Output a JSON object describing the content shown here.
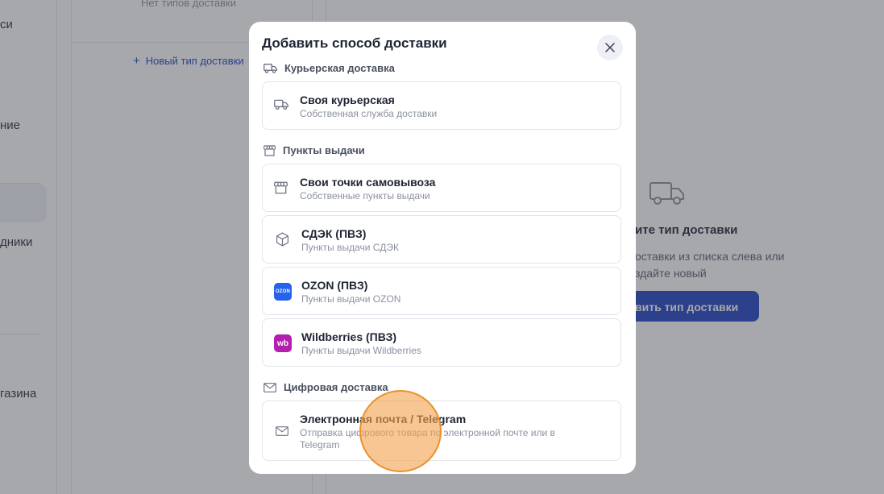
{
  "background": {
    "left_nav": {
      "fragments": [
        {
          "text": "си"
        },
        {
          "text": "ние"
        },
        {
          "text": "дники"
        },
        {
          "text": "газина"
        }
      ]
    },
    "types_panel": {
      "empty_text": "Нет типов доставки",
      "new_type_label": "Новый тип доставки",
      "plus_icon": "plus-icon"
    },
    "main": {
      "title": "ите тип доставки",
      "desc_line1": "оставки из списка слева или",
      "desc_line2": "здайте новый",
      "button_label": "вить тип доставки"
    }
  },
  "modal": {
    "title": "Добавить способ доставки",
    "close_icon": "close-icon",
    "sections": [
      {
        "label": "Курьерская доставка",
        "icon": "truck-icon",
        "items": [
          {
            "name": "Своя курьерская",
            "description": "Собственная служба доставки",
            "icon": "truck-icon"
          }
        ]
      },
      {
        "label": "Пункты выдачи",
        "icon": "store-icon",
        "items": [
          {
            "name": "Свои точки самовывоза",
            "description": "Собственные пункты выдачи",
            "icon": "store-icon"
          },
          {
            "name": "СДЭК (ПВЗ)",
            "description": "Пункты выдачи СДЭК",
            "icon": "package-icon"
          },
          {
            "name": "OZON (ПВЗ)",
            "description": "Пункты выдачи OZON",
            "icon": "ozon-logo",
            "logo_text": "OZON"
          },
          {
            "name": "Wildberries (ПВЗ)",
            "description": "Пункты выдачи Wildberries",
            "icon": "wildberries-logo",
            "logo_text": "wb"
          }
        ]
      },
      {
        "label": "Цифровая доставка",
        "icon": "mail-icon",
        "items": [
          {
            "name": "Электронная почта / Telegram",
            "description": "Отправка цифрового товара по электронной почте или в Telegram",
            "icon": "mail-icon"
          }
        ]
      }
    ]
  },
  "colors": {
    "accent": "#2143c4",
    "ozon": "#2563eb",
    "wildberries": "#b51fb0",
    "cursor_highlight": "#f4a350"
  }
}
